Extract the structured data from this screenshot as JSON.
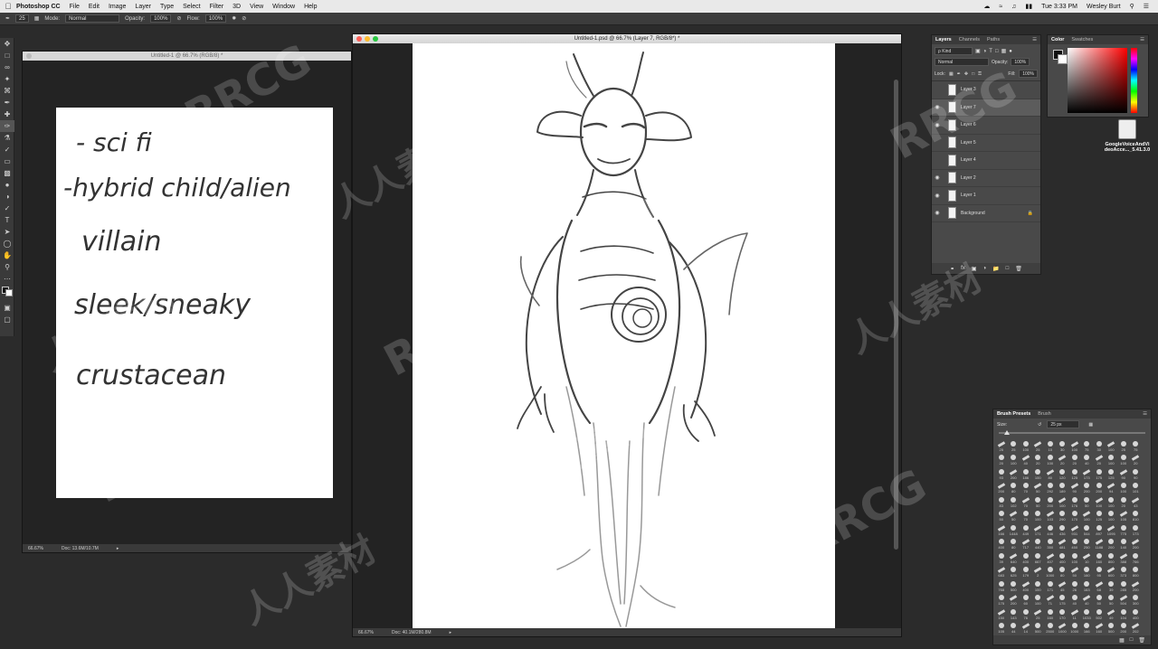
{
  "menubar": {
    "app_name": "Photoshop CC",
    "items": [
      "File",
      "Edit",
      "Image",
      "Layer",
      "Type",
      "Select",
      "Filter",
      "3D",
      "View",
      "Window",
      "Help"
    ],
    "clock": "Tue 3:33 PM",
    "user": "Wesley Burt"
  },
  "options_bar": {
    "brush_size": "25",
    "mode_label": "Mode:",
    "mode_value": "Normal",
    "opacity_label": "Opacity:",
    "opacity_value": "100%",
    "flow_label": "Flow:",
    "flow_value": "100%"
  },
  "doc_left": {
    "title": "Untitled-1 @ 66.7% (RGB/8) *",
    "zoom": "66.67%",
    "doc_info": "Doc: 13.6M/10.7M",
    "notes": [
      "- sci fi",
      "-hybrid child/alien",
      "villain",
      "sleek/sneaky",
      "crustacean"
    ]
  },
  "doc_main": {
    "title": "Untitled-1.psd @ 66.7% (Layer 7, RGB/8*) *",
    "zoom": "66.67%",
    "doc_info": "Doc: 40.1M/280.8M"
  },
  "layers_panel": {
    "tabs": [
      "Layers",
      "Channels",
      "Paths"
    ],
    "kind_label": "ρ Kind",
    "blend_mode": "Normal",
    "opacity_label": "Opacity:",
    "opacity_value": "100%",
    "lock_label": "Lock:",
    "fill_label": "Fill:",
    "fill_value": "100%",
    "layers": [
      {
        "name": "Layer 3",
        "visible": false,
        "selected": false
      },
      {
        "name": "Layer 7",
        "visible": true,
        "selected": true
      },
      {
        "name": "Layer 6",
        "visible": true,
        "selected": false
      },
      {
        "name": "Layer 5",
        "visible": false,
        "selected": false
      },
      {
        "name": "Layer 4",
        "visible": false,
        "selected": false
      },
      {
        "name": "Layer 2",
        "visible": true,
        "selected": false
      },
      {
        "name": "Layer 1",
        "visible": true,
        "selected": false
      },
      {
        "name": "Background",
        "visible": true,
        "selected": false
      }
    ],
    "footer_icons": [
      "link-icon",
      "fx-icon",
      "mask-icon",
      "adjustment-icon",
      "folder-icon",
      "new-layer-icon",
      "trash-icon"
    ]
  },
  "color_panel": {
    "tabs": [
      "Color",
      "Swatches"
    ],
    "fg_color": "#111111",
    "bg_color": "#ffffff"
  },
  "desktop": {
    "file_label_line1": "GoogleVoiceAndVi",
    "file_label_line2": "deoAcce..._5.41.3.0"
  },
  "brush_panel": {
    "tabs": [
      "Brush Presets",
      "Brush"
    ],
    "size_label": "Size:",
    "size_value": "25 px",
    "rows": [
      [
        "25",
        "25",
        "100",
        "25",
        "10",
        "30",
        "100",
        "75",
        "30",
        "100",
        "25",
        "75"
      ],
      [
        "20",
        "100",
        "40",
        "20",
        "100",
        "20",
        "20",
        "40",
        "20",
        "100",
        "100",
        "20"
      ],
      [
        "93",
        "200",
        "186",
        "100",
        "80",
        "120",
        "125",
        "173",
        "175",
        "125",
        "90",
        "90"
      ],
      [
        "200",
        "80",
        "70",
        "50",
        "292",
        "189",
        "90",
        "200",
        "200",
        "94",
        "100",
        "101"
      ],
      [
        "83",
        "102",
        "70",
        "50",
        "200",
        "100",
        "176",
        "50",
        "100",
        "100",
        "20",
        "43"
      ],
      [
        "50",
        "50",
        "70",
        "100",
        "103",
        "290",
        "170",
        "100",
        "125",
        "100",
        "105",
        "810"
      ],
      [
        "166",
        "1448",
        "449",
        "171",
        "446",
        "436",
        "931",
        "544",
        "897",
        "1095",
        "775",
        "173"
      ],
      [
        "400",
        "80",
        "717",
        "440",
        "350",
        "481",
        "450",
        "250",
        "1188",
        "200",
        "140",
        "200"
      ],
      [
        "39",
        "640",
        "400",
        "667",
        "407",
        "400",
        "100",
        "10",
        "160",
        "800",
        "388",
        "766"
      ],
      [
        "683",
        "625",
        "179",
        "2",
        "1000",
        "80",
        "50",
        "160",
        "95",
        "600",
        "373",
        "800"
      ],
      [
        "768",
        "500",
        "400",
        "100",
        "171",
        "45",
        "26",
        "163",
        "68",
        "39",
        "285",
        "200"
      ],
      [
        "175",
        "200",
        "60",
        "100",
        "71",
        "175",
        "40",
        "40",
        "50",
        "50",
        "504",
        "300"
      ],
      [
        "150",
        "143",
        "76",
        "25",
        "160",
        "170",
        "11",
        "1033",
        "502",
        "49",
        "104",
        "400"
      ],
      [
        "105",
        "44",
        "14",
        "500",
        "2500",
        "1000",
        "1000",
        "166",
        "160",
        "500",
        "200",
        "202"
      ]
    ]
  },
  "watermarks": [
    "RRCG",
    "人人素材"
  ]
}
